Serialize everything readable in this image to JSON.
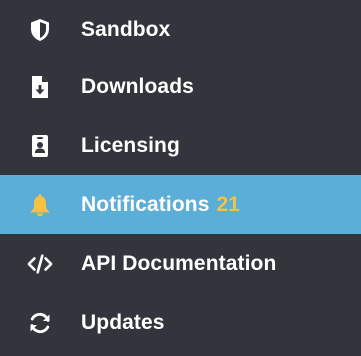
{
  "menu": {
    "items": [
      {
        "label": "Sandbox",
        "icon": "shield-icon"
      },
      {
        "label": "Downloads",
        "icon": "file-download-icon"
      },
      {
        "label": "Licensing",
        "icon": "id-badge-icon"
      },
      {
        "label": "Notifications",
        "icon": "bell-icon",
        "badge": "21",
        "active": true
      },
      {
        "label": "API Documentation",
        "icon": "code-icon"
      },
      {
        "label": "Updates",
        "icon": "sync-icon"
      }
    ]
  },
  "colors": {
    "background": "#32363c",
    "active_background": "#5aaed8",
    "text": "#ffffff",
    "accent": "#f5c242"
  }
}
